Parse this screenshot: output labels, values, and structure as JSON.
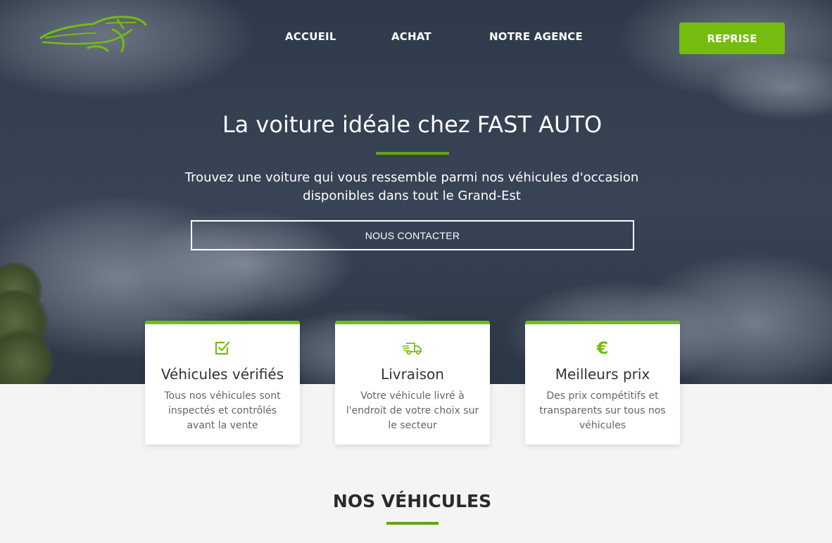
{
  "nav": {
    "links": [
      {
        "label": "ACCUEIL"
      },
      {
        "label": "ACHAT"
      },
      {
        "label": "NOTRE AGENCE"
      }
    ],
    "cta_label": "REPRISE"
  },
  "hero": {
    "title": "La voiture idéale chez FAST AUTO",
    "subtitle": "Trouvez une voiture qui vous ressemble parmi nos véhicules d'occasion disponibles dans tout le Grand-Est",
    "button_label": "NOUS CONTACTER"
  },
  "features": [
    {
      "icon": "checkbox-icon",
      "title": "Véhicules vérifiés",
      "text": "Tous nos véhicules sont inspectés et contrôlés avant la vente"
    },
    {
      "icon": "delivery-truck-icon",
      "title": "Livraison",
      "text": "Votre véhicule livré à l'endroit de votre choix sur le secteur"
    },
    {
      "icon": "euro-icon",
      "title": "Meilleurs prix",
      "text": "Des prix compétitifs et transparents sur tous nos véhicules"
    }
  ],
  "euro_symbol": "€",
  "section": {
    "title": "NOS VÉHICULES"
  },
  "colors": {
    "accent": "#74bd0e",
    "accent_dark": "#62a311",
    "hero_bg": "#3a4658",
    "page_bg": "#f4f4f4"
  }
}
